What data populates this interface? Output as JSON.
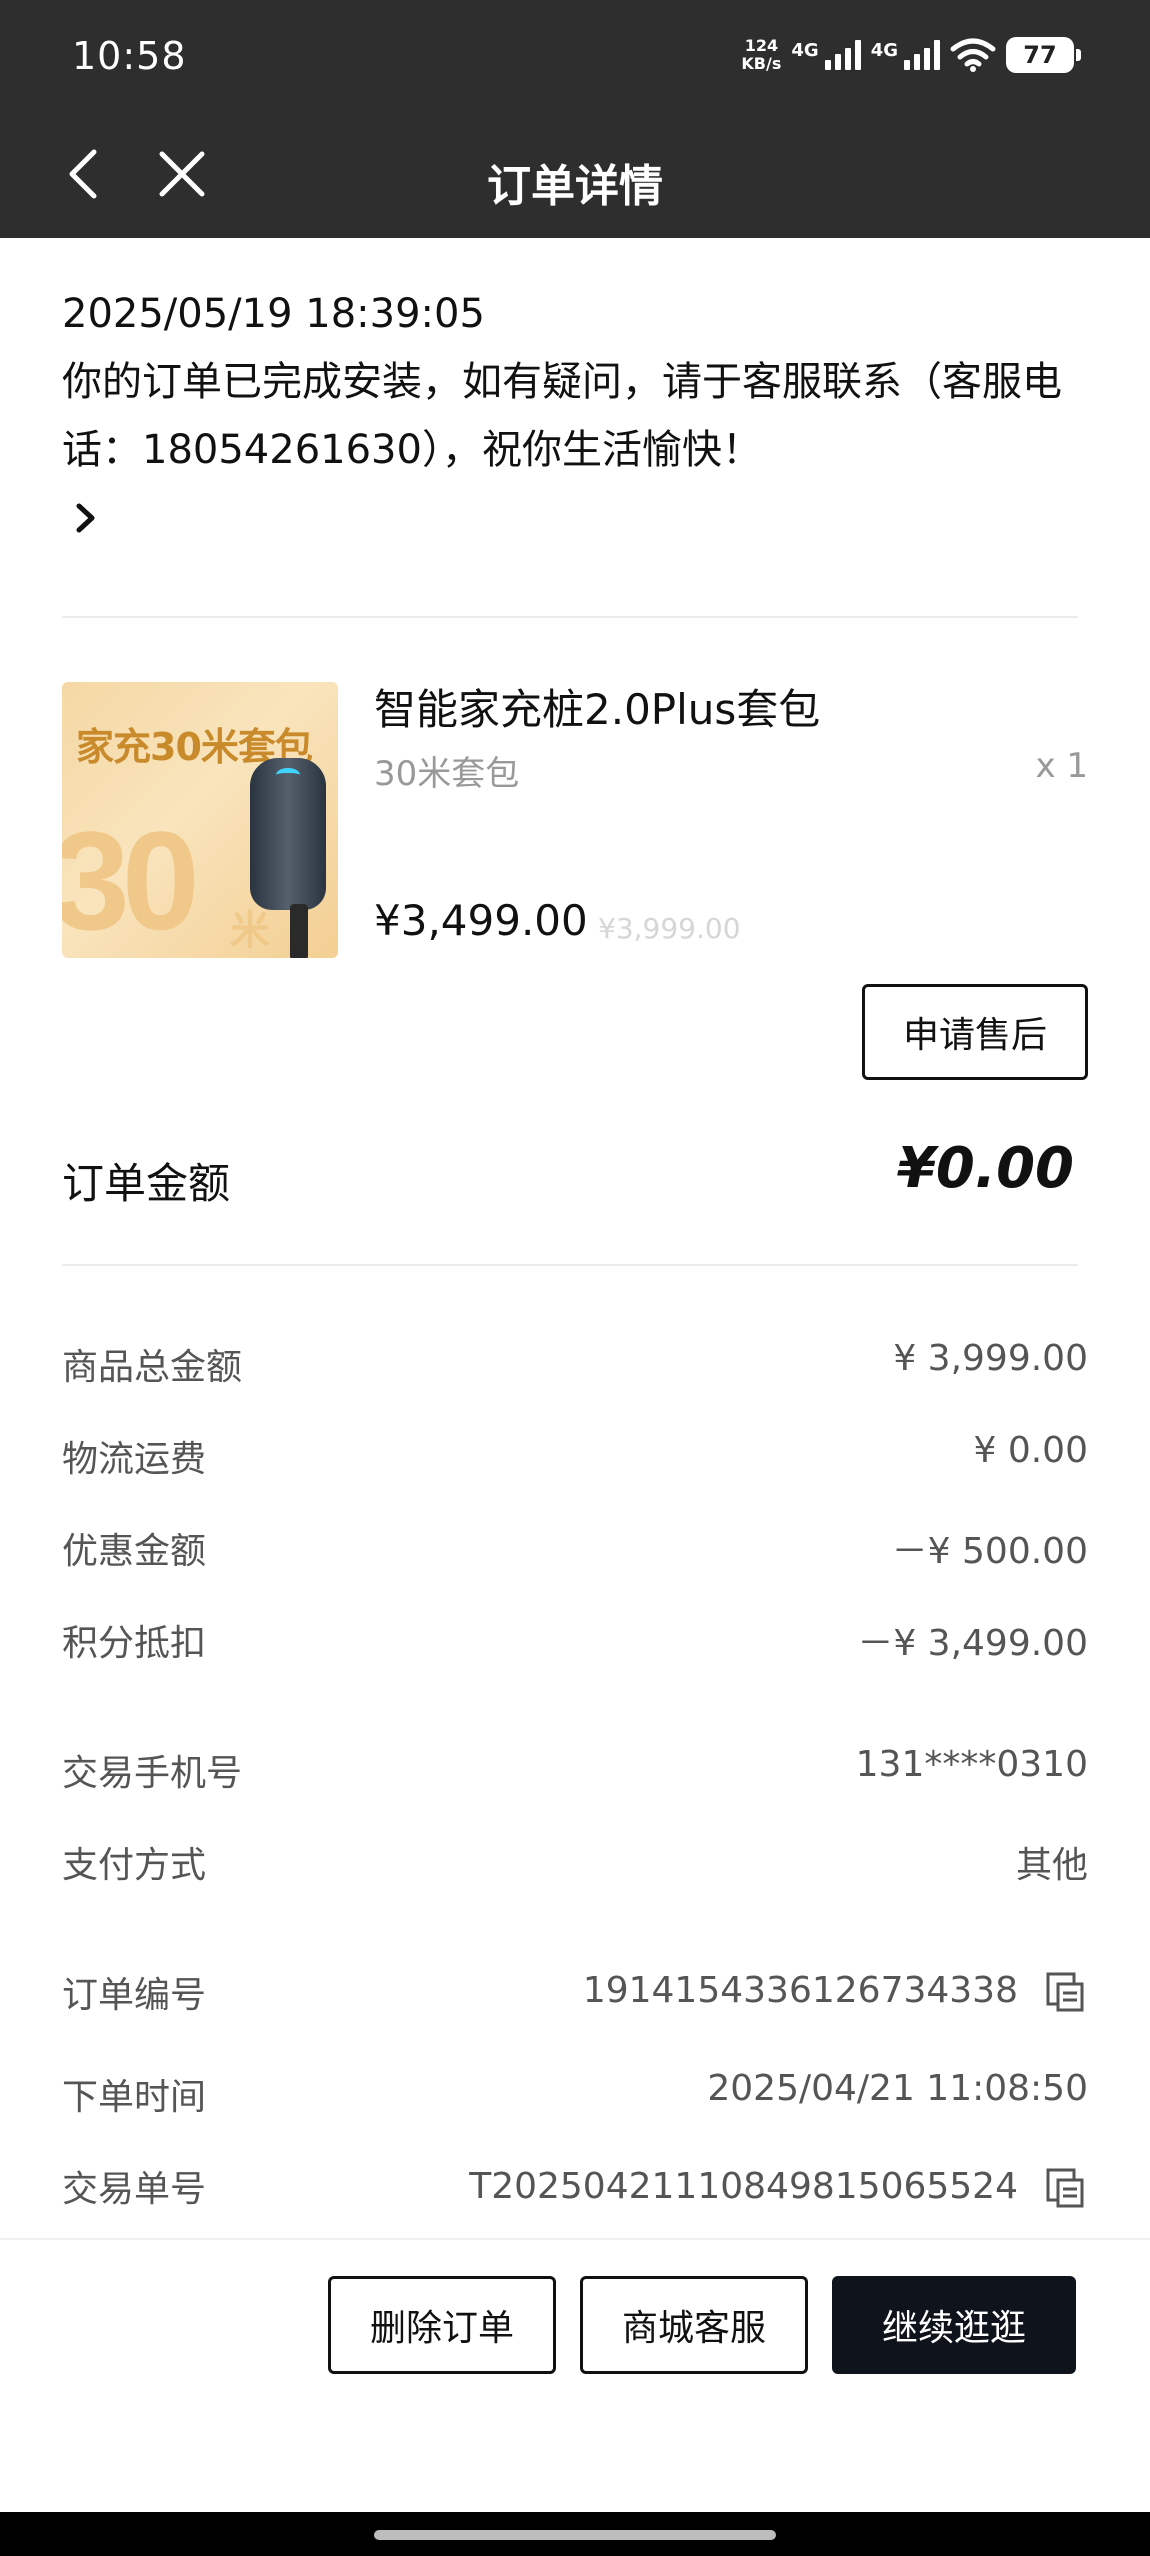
{
  "status_bar": {
    "time": "10:58",
    "net_speed_value": "124",
    "net_speed_unit": "KB/s",
    "signal_1_label": "4G",
    "signal_2_label": "4G",
    "battery": "77"
  },
  "nav": {
    "title": "订单详情",
    "back_icon": "chevron-left-icon",
    "close_icon": "close-icon"
  },
  "notice": {
    "time": "2025/05/19 18:39:05",
    "message": "你的订单已完成安装，如有疑问，请于客服联系（客服电话：18054261630），祝你生活愉快！"
  },
  "product": {
    "image_title": "家充30米套包",
    "image_big": "30",
    "image_unit": "米",
    "name": "智能家充桩2.0Plus套包",
    "spec": "30米套包",
    "quantity": "x 1",
    "price": "¥3,499.00",
    "original_price": "¥3,999.00",
    "after_sale_label": "申请售后"
  },
  "order_total": {
    "label": "订单金额",
    "value": "¥0.00"
  },
  "breakdown": [
    {
      "label": "商品总金额",
      "value": "¥ 3,999.00"
    },
    {
      "label": "物流运费",
      "value": "¥ 0.00"
    },
    {
      "label": "优惠金额",
      "value": "－¥ 500.00"
    },
    {
      "label": "积分抵扣",
      "value": "－¥ 3,499.00"
    }
  ],
  "payment": [
    {
      "label": "交易手机号",
      "value": "131****0310"
    },
    {
      "label": "支付方式",
      "value": "其他"
    }
  ],
  "order_info": [
    {
      "label": "订单编号",
      "value": "1914154336126734338"
    },
    {
      "label": "下单时间",
      "value": "2025/04/21 11:08:50"
    },
    {
      "label": "交易单号",
      "value": "T20250421110849815065524"
    }
  ],
  "actions": {
    "delete": "删除订单",
    "service": "商城客服",
    "continue": "继续逛逛"
  },
  "colors": {
    "header_bg": "#2e2e2e",
    "primary_button": "#0f141c",
    "secondary_text": "#555555"
  }
}
